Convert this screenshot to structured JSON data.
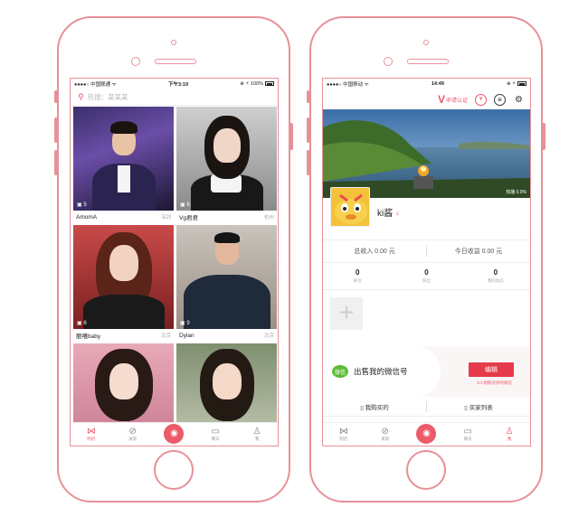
{
  "left": {
    "status": {
      "carrier": "●●●●○ 中国联通 ᯤ",
      "time": "下午3:19",
      "battery": "⊕ ⚡ 100%"
    },
    "search": {
      "placeholder": "热搜：某某某"
    },
    "cards": [
      {
        "name": "AmomA",
        "location": "深圳",
        "count": "5"
      },
      {
        "name": "Vg君君",
        "location": "杭州",
        "count": "6"
      },
      {
        "name": "丽嘻baby",
        "location": "北京",
        "count": "6"
      },
      {
        "name": "Dylan",
        "location": "北京",
        "count": "9"
      },
      {
        "name": "",
        "location": "",
        "count": ""
      },
      {
        "name": "",
        "location": "",
        "count": ""
      }
    ],
    "tabs": [
      {
        "label": "附近",
        "icon": "bowtie-icon"
      },
      {
        "label": "发现",
        "icon": "compass-icon"
      },
      {
        "label": "",
        "icon": "camera-icon"
      },
      {
        "label": "聊天",
        "icon": "chat-icon"
      },
      {
        "label": "我",
        "icon": "person-icon"
      }
    ]
  },
  "right": {
    "status": {
      "carrier": "●●●●○ 中国移动 ᯤ",
      "time": "14:49",
      "battery": "⊕ ⚡"
    },
    "topbar": {
      "verify_label": "申请认证",
      "verify_mark": "V",
      "icon1": "¥",
      "icon2": "⊕",
      "icon3": "⚙"
    },
    "banner": {
      "watermark": "热播 0.0%"
    },
    "profile": {
      "username": "ki酱",
      "gender": "♀"
    },
    "income": {
      "total": "总收入 0.00 元",
      "today": "今日收益 0.00 元"
    },
    "stats": [
      {
        "value": "0",
        "label": "关注"
      },
      {
        "value": "0",
        "label": "粉丝"
      },
      {
        "value": "0",
        "label": "我的动态"
      }
    ],
    "add_label": "+",
    "promo": {
      "text": "出售我的微信号",
      "button": "编辑",
      "hint": "0人想购买你的微信",
      "wechat": "微信"
    },
    "bought": {
      "mine": "我购买的",
      "buyers": "买家列表"
    },
    "tabs": [
      {
        "label": "附近",
        "icon": "bowtie-icon"
      },
      {
        "label": "发现",
        "icon": "compass-icon"
      },
      {
        "label": "",
        "icon": "camera-icon"
      },
      {
        "label": "聊天",
        "icon": "chat-icon"
      },
      {
        "label": "我",
        "icon": "person-icon"
      }
    ]
  },
  "colors": {
    "accent": "#e9566a",
    "frame": "#e89098",
    "button": "#e53b4a",
    "wechat": "#5dbb3a"
  }
}
